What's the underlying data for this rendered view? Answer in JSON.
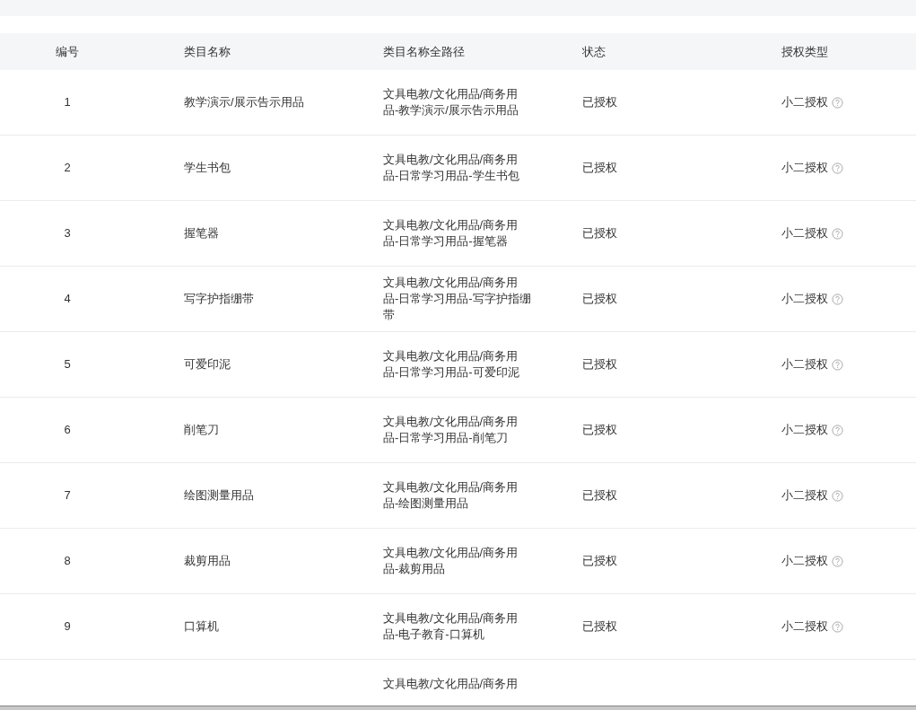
{
  "table": {
    "columns": [
      "编号",
      "类目名称",
      "类目名称全路径",
      "状态",
      "授权类型"
    ],
    "rows": [
      {
        "number": "1",
        "name": "教学演示/展示告示用品",
        "path": "文具电教/文化用品/商务用品-教学演示/展示告示用品",
        "status": "已授权",
        "type": "小二授权"
      },
      {
        "number": "2",
        "name": "学生书包",
        "path": "文具电教/文化用品/商务用品-日常学习用品-学生书包",
        "status": "已授权",
        "type": "小二授权"
      },
      {
        "number": "3",
        "name": "握笔器",
        "path": "文具电教/文化用品/商务用品-日常学习用品-握笔器",
        "status": "已授权",
        "type": "小二授权"
      },
      {
        "number": "4",
        "name": "写字护指绷带",
        "path": "文具电教/文化用品/商务用品-日常学习用品-写字护指绷带",
        "status": "已授权",
        "type": "小二授权"
      },
      {
        "number": "5",
        "name": "可爱印泥",
        "path": "文具电教/文化用品/商务用品-日常学习用品-可爱印泥",
        "status": "已授权",
        "type": "小二授权"
      },
      {
        "number": "6",
        "name": "削笔刀",
        "path": "文具电教/文化用品/商务用品-日常学习用品-削笔刀",
        "status": "已授权",
        "type": "小二授权"
      },
      {
        "number": "7",
        "name": "绘图测量用品",
        "path": "文具电教/文化用品/商务用品-绘图测量用品",
        "status": "已授权",
        "type": "小二授权"
      },
      {
        "number": "8",
        "name": "裁剪用品",
        "path": "文具电教/文化用品/商务用品-裁剪用品",
        "status": "已授权",
        "type": "小二授权"
      },
      {
        "number": "9",
        "name": "口算机",
        "path": "文具电教/文化用品/商务用品-电子教育-口算机",
        "status": "已授权",
        "type": "小二授权"
      }
    ],
    "partial_row": {
      "path": "文具电教/文化用品/商务用"
    }
  }
}
